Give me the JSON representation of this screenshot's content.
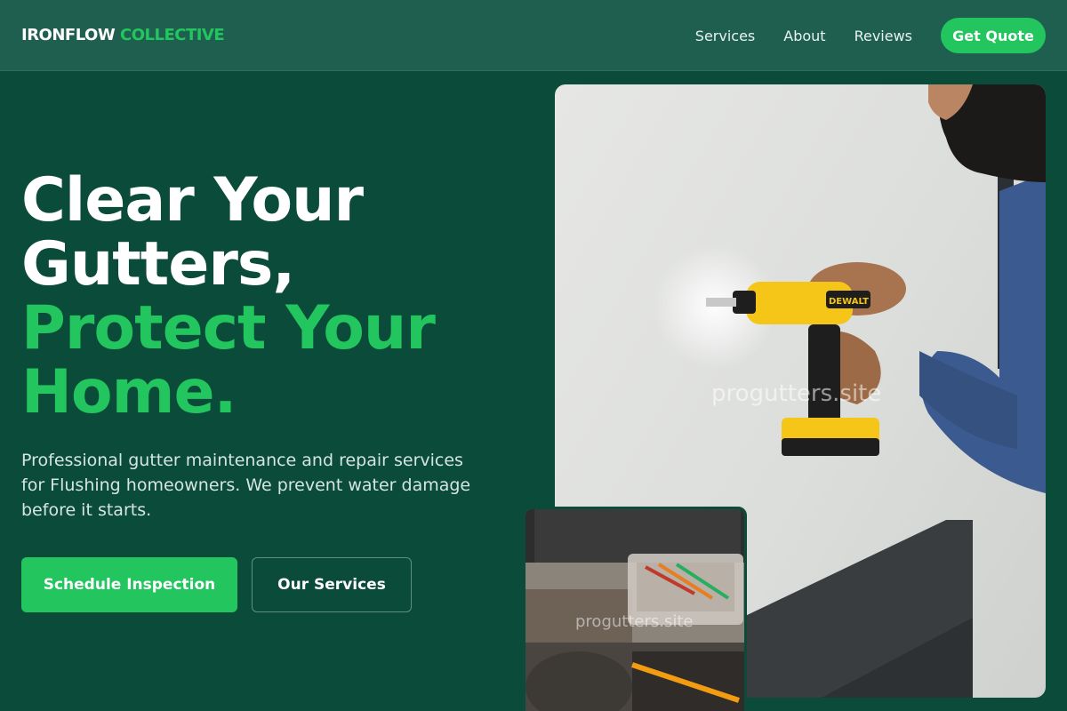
{
  "brand": {
    "name_part1": "IRONFLOW",
    "name_part2": "COLLECTIVE"
  },
  "nav": {
    "items": [
      "Services",
      "About",
      "Reviews"
    ],
    "cta": "Get Quote"
  },
  "hero": {
    "headline_white_1": "Clear Your",
    "headline_white_2": "Gutters,",
    "headline_green_1": "Protect Your",
    "headline_green_2": "Home.",
    "subtext": "Professional gutter maintenance and repair services for Flushing homeowners. We prevent water damage before it starts.",
    "primary_button": "Schedule Inspection",
    "secondary_button": "Our Services"
  },
  "images": {
    "main_watermark": "progutters.site",
    "overlay_watermark": "progutters.site",
    "drill_brand": "DEWALT"
  },
  "colors": {
    "accent": "#22c55e",
    "background": "#0b4b3a",
    "header": "#1f5f50"
  }
}
